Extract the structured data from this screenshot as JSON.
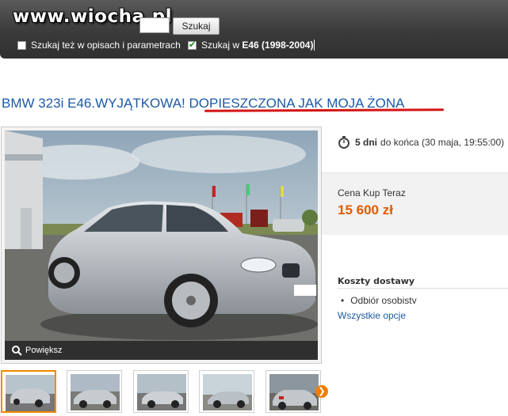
{
  "watermark": "www.wiocha.pl",
  "search": {
    "input_value": "",
    "button_label": "Szukaj",
    "option1_label": "Szukaj też w opisach i parametrach",
    "option1_checked": false,
    "option2_prefix": "Szukaj w",
    "option2_category": "E46 (1998-2004)",
    "option2_checked": true
  },
  "listing": {
    "title_part1": "BMW 323i E46.WYJĄTKOWA! ",
    "title_part2": "DOPIESZCZONA JAK MOJA ŻONA",
    "zoom_label": "Powiększ",
    "time_left_bold": "5 dni",
    "time_left_rest": "do końca (30 maja, 19:55:00)",
    "buy_now_label": "Cena Kup Teraz",
    "buy_now_price": "15 600 zł",
    "shipping_heading": "Koszty dostawy",
    "shipping_item": "Odbiór osobisty",
    "shipping_link": "Wszystkie opcje",
    "thumbnail_count": 5,
    "selected_thumbnail": 1
  },
  "colors": {
    "title": "#1d5aa6",
    "price": "#e25a00",
    "underline": "#d41515",
    "thumb_selected": "#f28a00"
  }
}
